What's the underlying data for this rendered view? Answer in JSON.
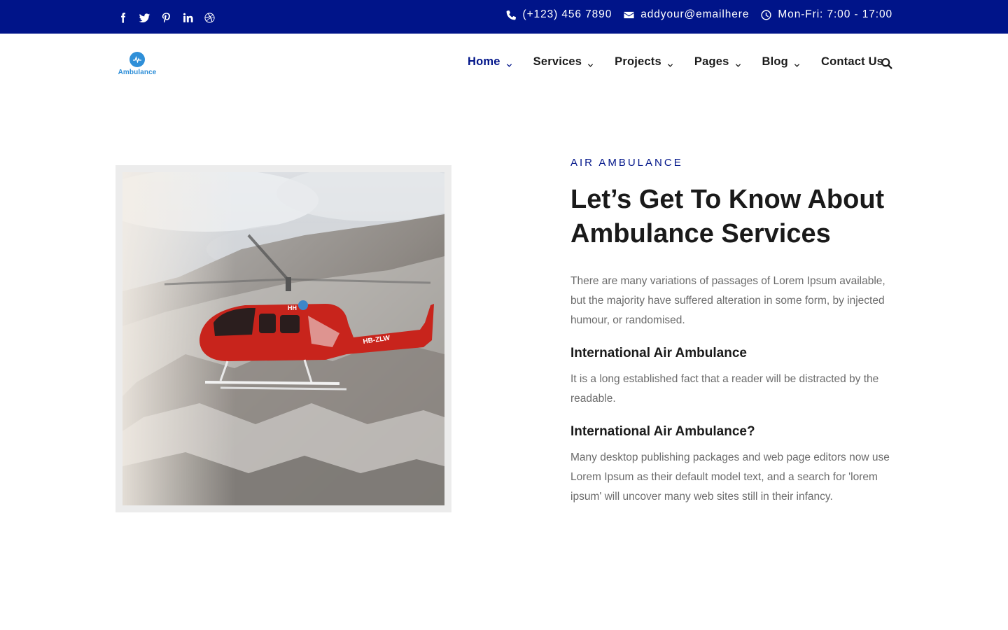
{
  "topbar": {
    "background": "#001489",
    "social_icons": [
      "facebook-icon",
      "twitter-icon",
      "pinterest-icon",
      "linkedin-icon",
      "dribbble-icon"
    ],
    "phone": "(+123) 456 7890",
    "email": "addyour@emailhere",
    "hours": "Mon-Fri: 7:00 - 17:00"
  },
  "header": {
    "logo_text": "Ambulance",
    "nav": [
      {
        "label": "Home",
        "dropdown": true,
        "active": true
      },
      {
        "label": "Services",
        "dropdown": true
      },
      {
        "label": "Projects",
        "dropdown": true
      },
      {
        "label": "Pages",
        "dropdown": true
      },
      {
        "label": "Blog",
        "dropdown": true
      },
      {
        "label": "Contact Us",
        "dropdown": false
      }
    ],
    "accent": "#001489"
  },
  "about": {
    "eyebrow": "AIR AMBULANCE",
    "title": "Let’s Get To Know About Ambulance Services",
    "intro": "There are many variations of passages of Lorem Ipsum available, but the majority have suffered alteration in some form, by injected humour, or randomised.",
    "blocks": [
      {
        "heading": "International Air Ambulance",
        "text": "It is a long established fact that a reader will be distracted by the readable."
      },
      {
        "heading": "International Air Ambulance?",
        "text": "Many desktop publishing packages and web page editors now use Lorem Ipsum as their default model text, and a search for 'lorem ipsum' will uncover many web sites still in their infancy."
      }
    ]
  },
  "image": {
    "helicopter_registration": "HB-ZLW",
    "helicopter_marking": "HH"
  }
}
